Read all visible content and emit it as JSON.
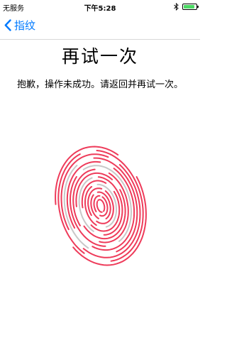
{
  "status_bar": {
    "carrier": "无服务",
    "time": "下午5:28",
    "bluetooth_icon": "bluetooth-icon",
    "battery_level": 0.9,
    "battery_color": "#4cd964"
  },
  "nav": {
    "back_label": "指纹",
    "back_icon": "chevron-left-icon",
    "accent_color": "#007aff"
  },
  "main": {
    "title": "再试一次",
    "message": "抱歉，操作未成功。请返回并再试一次。"
  },
  "fingerprint": {
    "icon": "fingerprint-icon",
    "color": "#ee3b5a",
    "gray_color": "#c8c8c8"
  }
}
